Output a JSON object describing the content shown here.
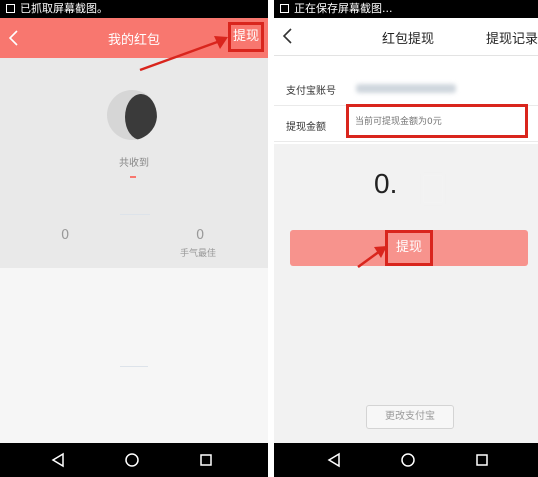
{
  "left_screen": {
    "status_text": "已抓取屏幕截图。",
    "title": "我的红包",
    "withdraw_label": "提现",
    "received_label": "共收到",
    "stats": [
      {
        "value": "0",
        "label": ""
      },
      {
        "value": "0",
        "label": "手气最佳"
      }
    ]
  },
  "right_screen": {
    "status_text": "正在保存屏幕截图...",
    "title": "红包提现",
    "records_label": "提现记录",
    "alipay_account_label": "支付宝账号",
    "withdraw_amount_label": "提现金额",
    "amount_placeholder": "当前可提现金额为0元",
    "balance": "0.",
    "withdraw_button": "提现",
    "change_alipay_button": "更改支付宝"
  },
  "icons": {
    "back": "chevron-left-icon",
    "nav_back": "triangle-back-icon",
    "nav_home": "circle-home-icon",
    "nav_recent": "square-recent-icon"
  },
  "colors": {
    "header_coral": "#f8776f",
    "highlight_red": "#d9251d",
    "button_pink": "#f7938d"
  }
}
